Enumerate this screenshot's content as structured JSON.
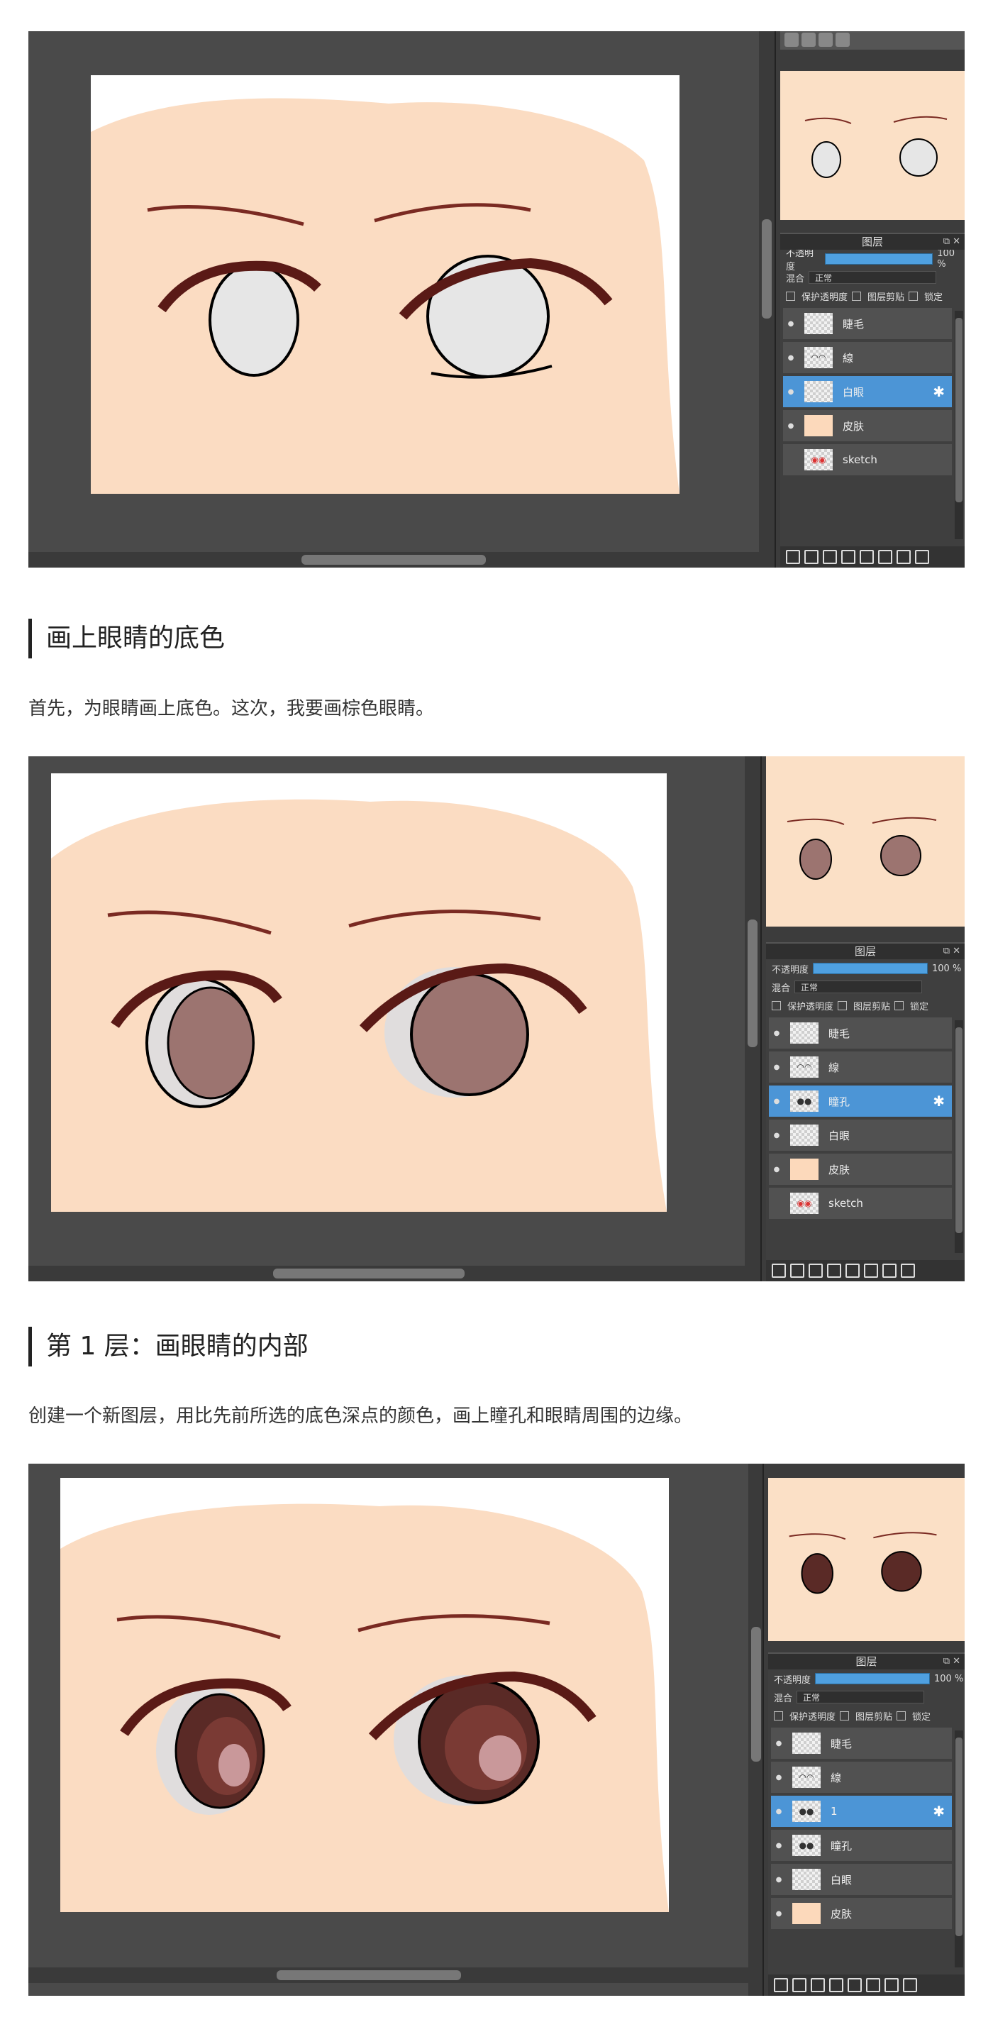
{
  "screens": [
    {
      "layer_panel": {
        "title": "图层",
        "controls": "⧉ ✕",
        "opacity_label": "不透明度",
        "opacity_value": "100 %",
        "blend_label": "混合",
        "blend_value": "正常",
        "opt_protect": "保护透明度",
        "opt_clip": "图层剪贴",
        "opt_lock": "锁定",
        "layers": [
          {
            "name": "睫毛",
            "active": false
          },
          {
            "name": "線",
            "active": false
          },
          {
            "name": "白眼",
            "active": true
          },
          {
            "name": "皮肤",
            "active": false
          },
          {
            "name": "sketch",
            "active": false
          }
        ]
      }
    },
    {
      "layer_panel": {
        "title": "图层",
        "controls": "⧉ ✕",
        "opacity_label": "不透明度",
        "opacity_value": "100 %",
        "blend_label": "混合",
        "blend_value": "正常",
        "opt_protect": "保护透明度",
        "opt_clip": "图层剪贴",
        "opt_lock": "锁定",
        "layers": [
          {
            "name": "睫毛",
            "active": false
          },
          {
            "name": "線",
            "active": false
          },
          {
            "name": "瞳孔",
            "active": true
          },
          {
            "name": "白眼",
            "active": false
          },
          {
            "name": "皮肤",
            "active": false
          },
          {
            "name": "sketch",
            "active": false
          }
        ]
      }
    },
    {
      "layer_panel": {
        "title": "图层",
        "controls": "⧉ ✕",
        "opacity_label": "不透明度",
        "opacity_value": "100 %",
        "blend_label": "混合",
        "blend_value": "正常",
        "opt_protect": "保护透明度",
        "opt_clip": "图层剪贴",
        "opt_lock": "锁定",
        "layers": [
          {
            "name": "睫毛",
            "active": false
          },
          {
            "name": "線",
            "active": false
          },
          {
            "name": "1",
            "active": true
          },
          {
            "name": "瞳孔",
            "active": false
          },
          {
            "name": "白眼",
            "active": false
          },
          {
            "name": "皮肤",
            "active": false
          }
        ]
      }
    }
  ],
  "sections": [
    {
      "heading": "画上眼睛的底色",
      "text": "首先，为眼睛画上底色。这次，我要画棕色眼睛。"
    },
    {
      "heading": "第 1 层：画眼睛的内部",
      "text": "创建一个新图层，用比先前所选的底色深点的颜色，画上瞳孔和眼睛周围的边缘。"
    }
  ],
  "colors": {
    "skin": "#fbdcc2",
    "line": "#6e1f1a",
    "iris_base": "#9c7470",
    "iris_dark": "#5a2a26",
    "highlight": "#4c95d6"
  }
}
